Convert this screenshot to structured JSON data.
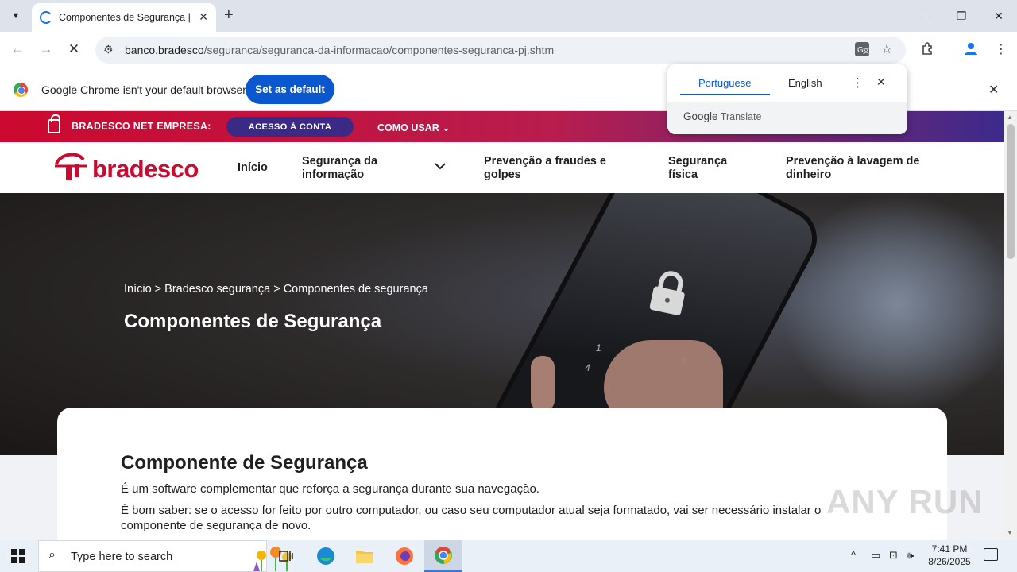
{
  "browser": {
    "tab_title": "Componentes de Segurança | B",
    "url_host": "banco.bradesco",
    "url_path": "/seguranca/seguranca-da-informacao/componentes-seguranca-pj.shtm",
    "infobar_text": "Google Chrome isn't your default browser",
    "set_default_label": "Set as default"
  },
  "translate_popup": {
    "lang_source": "Portuguese",
    "lang_target": "English",
    "brand_google": "Google",
    "brand_translate": "Translate"
  },
  "site_topbar": {
    "net_empresa": "BRADESCO NET EMPRESA:",
    "acesso_button": "ACESSO À CONTA",
    "como_usar": "COMO USAR"
  },
  "site_nav": {
    "logo_text": "bradesco",
    "inicio": "Início",
    "seguranca_info_1": "Segurança da",
    "seguranca_info_2": "informação",
    "prevencao_fraudes_1": "Prevenção a fraudes e",
    "prevencao_fraudes_2": "golpes",
    "seguranca_fisica_1": "Segurança",
    "seguranca_fisica_2": "física",
    "prevencao_lavagem_1": "Prevenção à lavagem de",
    "prevencao_lavagem_2": "dinheiro"
  },
  "hero": {
    "breadcrumb": "Início > Bradesco segurança > Componentes de segurança",
    "title": "Componentes de Segurança",
    "keys": [
      "1",
      "4",
      "3"
    ]
  },
  "content": {
    "heading": "Componente de Segurança",
    "paragraph1": "É um software complementar que reforça a segurança durante sua navegação.",
    "paragraph2": "É bom saber: se o acesso for feito por outro computador, ou caso seu computador atual seja formatado, vai ser necessário instalar o componente de segurança de novo."
  },
  "watermark": "ANY RUN",
  "taskbar": {
    "search_placeholder": "Type here to search",
    "time": "7:41 PM",
    "date": "8/26/2025"
  },
  "colors": {
    "brand_red": "#cc092f",
    "brand_purple": "#3b2a85",
    "chrome_blue": "#0b57d0"
  }
}
